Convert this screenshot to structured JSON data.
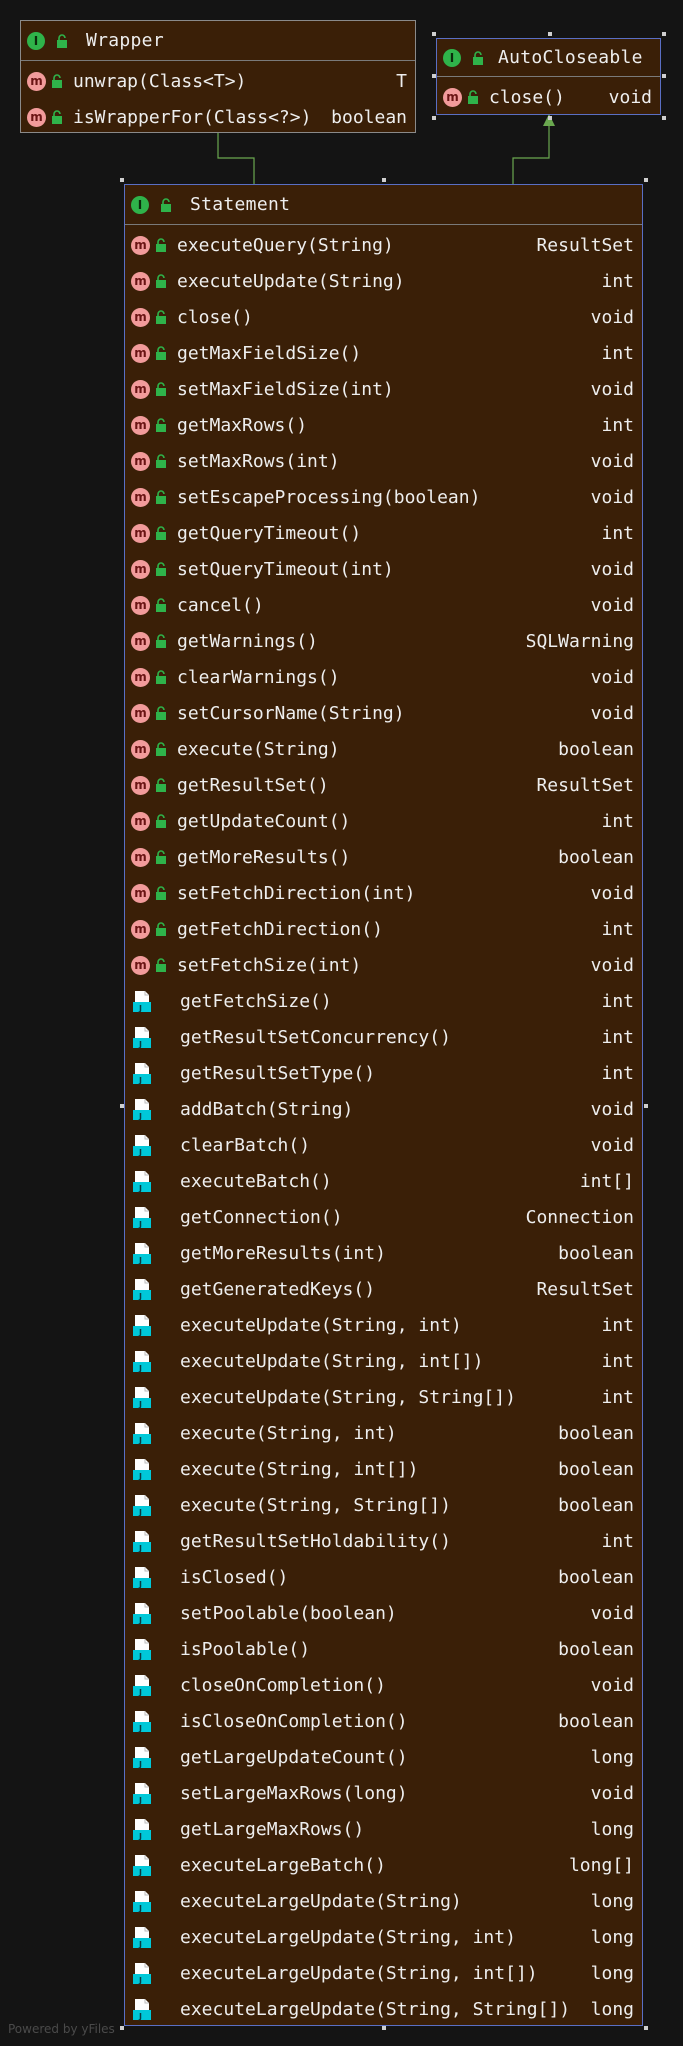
{
  "diagram": {
    "wrapper": {
      "name": "Wrapper",
      "methods": [
        {
          "sig": "unwrap(Class<T>)",
          "ret": "T"
        },
        {
          "sig": "isWrapperFor(Class<?>)",
          "ret": "boolean"
        }
      ]
    },
    "autocloseable": {
      "name": "AutoCloseable",
      "methods": [
        {
          "sig": "close()",
          "ret": "void"
        }
      ]
    },
    "statement": {
      "name": "Statement",
      "methods": [
        {
          "sig": "executeQuery(String)",
          "ret": "ResultSet",
          "kind": "abstract"
        },
        {
          "sig": "executeUpdate(String)",
          "ret": "int",
          "kind": "abstract"
        },
        {
          "sig": "close()",
          "ret": "void",
          "kind": "abstract"
        },
        {
          "sig": "getMaxFieldSize()",
          "ret": "int",
          "kind": "abstract"
        },
        {
          "sig": "setMaxFieldSize(int)",
          "ret": "void",
          "kind": "abstract"
        },
        {
          "sig": "getMaxRows()",
          "ret": "int",
          "kind": "abstract"
        },
        {
          "sig": "setMaxRows(int)",
          "ret": "void",
          "kind": "abstract"
        },
        {
          "sig": "setEscapeProcessing(boolean)",
          "ret": "void",
          "kind": "abstract"
        },
        {
          "sig": "getQueryTimeout()",
          "ret": "int",
          "kind": "abstract"
        },
        {
          "sig": "setQueryTimeout(int)",
          "ret": "void",
          "kind": "abstract"
        },
        {
          "sig": "cancel()",
          "ret": "void",
          "kind": "abstract"
        },
        {
          "sig": "getWarnings()",
          "ret": "SQLWarning",
          "kind": "abstract"
        },
        {
          "sig": "clearWarnings()",
          "ret": "void",
          "kind": "abstract"
        },
        {
          "sig": "setCursorName(String)",
          "ret": "void",
          "kind": "abstract"
        },
        {
          "sig": "execute(String)",
          "ret": "boolean",
          "kind": "abstract"
        },
        {
          "sig": "getResultSet()",
          "ret": "ResultSet",
          "kind": "abstract"
        },
        {
          "sig": "getUpdateCount()",
          "ret": "int",
          "kind": "abstract"
        },
        {
          "sig": "getMoreResults()",
          "ret": "boolean",
          "kind": "abstract"
        },
        {
          "sig": "setFetchDirection(int)",
          "ret": "void",
          "kind": "abstract"
        },
        {
          "sig": "getFetchDirection()",
          "ret": "int",
          "kind": "abstract"
        },
        {
          "sig": "setFetchSize(int)",
          "ret": "void",
          "kind": "abstract"
        },
        {
          "sig": "getFetchSize()",
          "ret": "int",
          "kind": "doc"
        },
        {
          "sig": "getResultSetConcurrency()",
          "ret": "int",
          "kind": "doc"
        },
        {
          "sig": "getResultSetType()",
          "ret": "int",
          "kind": "doc"
        },
        {
          "sig": "addBatch(String)",
          "ret": "void",
          "kind": "doc"
        },
        {
          "sig": "clearBatch()",
          "ret": "void",
          "kind": "doc"
        },
        {
          "sig": "executeBatch()",
          "ret": "int[]",
          "kind": "doc"
        },
        {
          "sig": "getConnection()",
          "ret": "Connection",
          "kind": "doc"
        },
        {
          "sig": "getMoreResults(int)",
          "ret": "boolean",
          "kind": "doc"
        },
        {
          "sig": "getGeneratedKeys()",
          "ret": "ResultSet",
          "kind": "doc"
        },
        {
          "sig": "executeUpdate(String, int)",
          "ret": "int",
          "kind": "doc"
        },
        {
          "sig": "executeUpdate(String, int[])",
          "ret": "int",
          "kind": "doc"
        },
        {
          "sig": "executeUpdate(String, String[])",
          "ret": "int",
          "kind": "doc"
        },
        {
          "sig": "execute(String, int)",
          "ret": "boolean",
          "kind": "doc"
        },
        {
          "sig": "execute(String, int[])",
          "ret": "boolean",
          "kind": "doc"
        },
        {
          "sig": "execute(String, String[])",
          "ret": "boolean",
          "kind": "doc"
        },
        {
          "sig": "getResultSetHoldability()",
          "ret": "int",
          "kind": "doc"
        },
        {
          "sig": "isClosed()",
          "ret": "boolean",
          "kind": "doc"
        },
        {
          "sig": "setPoolable(boolean)",
          "ret": "void",
          "kind": "doc"
        },
        {
          "sig": "isPoolable()",
          "ret": "boolean",
          "kind": "doc"
        },
        {
          "sig": "closeOnCompletion()",
          "ret": "void",
          "kind": "doc"
        },
        {
          "sig": "isCloseOnCompletion()",
          "ret": "boolean",
          "kind": "doc"
        },
        {
          "sig": "getLargeUpdateCount()",
          "ret": "long",
          "kind": "doc"
        },
        {
          "sig": "setLargeMaxRows(long)",
          "ret": "void",
          "kind": "doc"
        },
        {
          "sig": "getLargeMaxRows()",
          "ret": "long",
          "kind": "doc"
        },
        {
          "sig": "executeLargeBatch()",
          "ret": "long[]",
          "kind": "doc"
        },
        {
          "sig": "executeLargeUpdate(String)",
          "ret": "long",
          "kind": "doc"
        },
        {
          "sig": "executeLargeUpdate(String, int)",
          "ret": "long",
          "kind": "doc"
        },
        {
          "sig": "executeLargeUpdate(String, int[])",
          "ret": "long",
          "kind": "doc"
        },
        {
          "sig": "executeLargeUpdate(String, String[])",
          "ret": "long",
          "kind": "doc"
        }
      ]
    }
  },
  "icons": {
    "interface": "I",
    "method": "m"
  },
  "colors": {
    "background": "#141414",
    "node_fill": "#3a1f07",
    "edge": "#6aa84f",
    "interface_badge": "#2fb34a",
    "method_badge": "#f29b9b",
    "doc_icon": "#00c8d8"
  },
  "footer": "Powered by yFiles"
}
